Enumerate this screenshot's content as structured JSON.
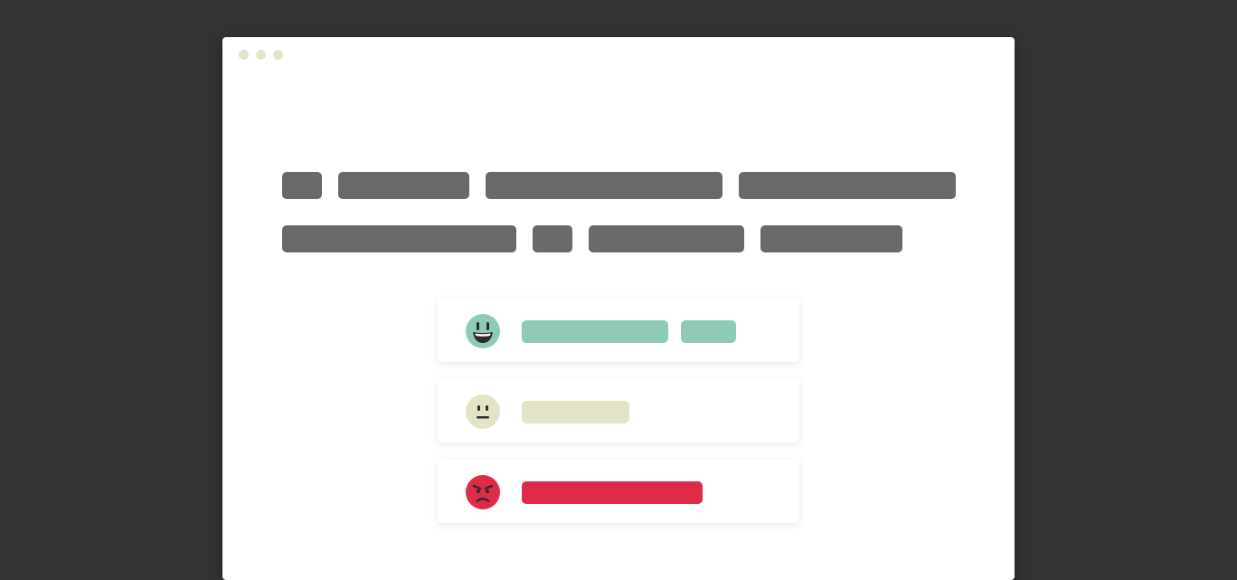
{
  "colors": {
    "background": "#333333",
    "window": "#ffffff",
    "dot": "#e4e4cc",
    "text_placeholder": "#696969",
    "positive": "#8ecbb4",
    "neutral": "#e3e3c7",
    "negative": "#dd2b48"
  },
  "window_dots": [
    "dot",
    "dot",
    "dot"
  ],
  "text_lines": [
    {
      "words": [
        44,
        145,
        262,
        240
      ]
    },
    {
      "words": [
        259,
        44,
        172,
        157
      ]
    }
  ],
  "feedback_cards": [
    {
      "sentiment": "positive",
      "icon": "happy-face-icon",
      "color": "#8ecbb4",
      "bars": [
        162,
        61
      ]
    },
    {
      "sentiment": "neutral",
      "icon": "neutral-face-icon",
      "color": "#e3e3c7",
      "bars": [
        119
      ]
    },
    {
      "sentiment": "negative",
      "icon": "angry-face-icon",
      "color": "#dd2b48",
      "bars": [
        200
      ]
    }
  ]
}
